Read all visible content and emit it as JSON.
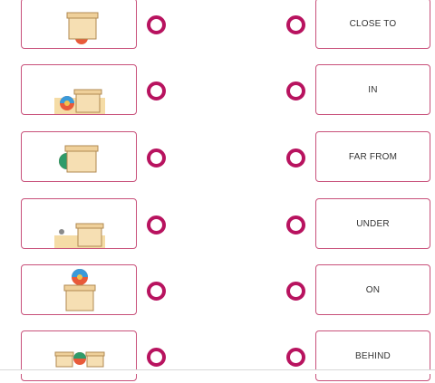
{
  "pairs": [
    {
      "scene": "box-with-ball-under",
      "word": "CLOSE TO"
    },
    {
      "scene": "ball-next-to-box-on-mat",
      "word": "IN"
    },
    {
      "scene": "ball-behind-box",
      "word": "FAR FROM"
    },
    {
      "scene": "small-ball-far-from-box",
      "word": "UNDER"
    },
    {
      "scene": "ball-on-box",
      "word": "ON"
    },
    {
      "scene": "ball-between-boxes",
      "word": "BEHIND"
    }
  ],
  "colors": {
    "card_border": "#c8507a",
    "ring": "#b8135f",
    "box_fill": "#f6dfb3",
    "box_stroke": "#b08a52",
    "mat": "#f5dca6"
  }
}
